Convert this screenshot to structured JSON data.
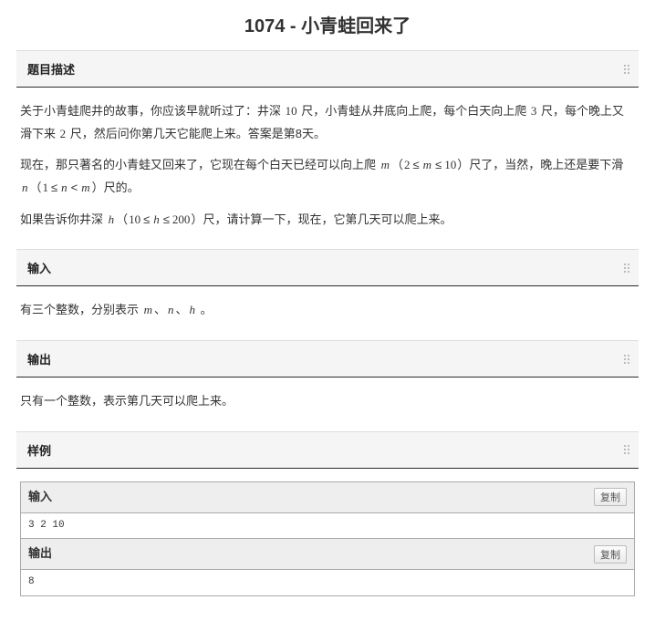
{
  "title": "1074 - 小青蛙回来了",
  "sections": {
    "desc": {
      "header": "题目描述",
      "p1_a": "关于小青蛙爬井的故事，你应该早就听过了：井深 ",
      "p1_num1": "10",
      "p1_b": " 尺，小青蛙从井底向上爬，每个白天向上爬 ",
      "p1_num2": "3",
      "p1_c": " 尺，每个晚上又滑下来 ",
      "p1_num3": "2",
      "p1_d": " 尺，然后问你第几天它能爬上来。答案是第8天。",
      "p2_a": "现在，那只著名的小青蛙又回来了，它现在每个白天已经可以向上爬 ",
      "p2_var1": "m",
      "p2_open1": "（",
      "p2_c1a": "2",
      "p2_rel1": "≤",
      "p2_c1b": "m",
      "p2_rel2": "≤",
      "p2_c1c": "10",
      "p2_close1": "）",
      "p2_b": "尺了，当然，晚上还是要下滑 ",
      "p2_var2": "n",
      "p2_open2": "（",
      "p2_c2a": "1",
      "p2_rel3": "≤",
      "p2_c2b": "n",
      "p2_rel4": "<",
      "p2_c2c": "m",
      "p2_close2": "）",
      "p2_c": "尺的。",
      "p3_a": "如果告诉你井深 ",
      "p3_var1": "h",
      "p3_open1": "（",
      "p3_c1a": "10",
      "p3_rel1": "≤",
      "p3_c1b": "h",
      "p3_rel2": "≤",
      "p3_c1c": "200",
      "p3_close1": "）",
      "p3_b": "尺，请计算一下，现在，它第几天可以爬上来。"
    },
    "input": {
      "header": "输入",
      "p1_a": "有三个整数，分别表示 ",
      "p1_v1": "m",
      "p1_s1": "、",
      "p1_v2": "n",
      "p1_s2": "、",
      "p1_v3": "h",
      "p1_end": " 。"
    },
    "output": {
      "header": "输出",
      "p1": "只有一个整数，表示第几天可以爬上来。"
    },
    "sample": {
      "header": "样例",
      "in_label": "输入",
      "in_val": "3 2 10",
      "out_label": "输出",
      "out_val": "8",
      "copy": "复制"
    }
  }
}
